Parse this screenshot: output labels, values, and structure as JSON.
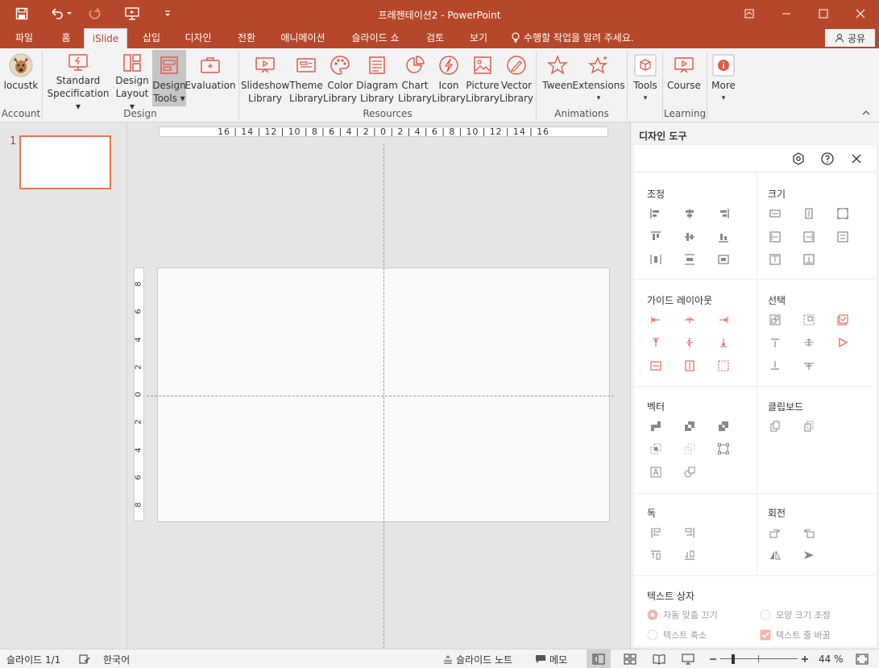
{
  "window": {
    "title": "프레젠테이션2 - PowerPoint"
  },
  "tabs": [
    {
      "label": "파일"
    },
    {
      "label": "홈"
    },
    {
      "label": "iSlide"
    },
    {
      "label": "삽입"
    },
    {
      "label": "디자인"
    },
    {
      "label": "전환"
    },
    {
      "label": "애니메이션"
    },
    {
      "label": "슬라이드 쇼"
    },
    {
      "label": "검토"
    },
    {
      "label": "보기"
    }
  ],
  "tell_me": "수행할 작업을 알려 주세요.",
  "share": "공유",
  "ribbon": {
    "account": {
      "label": "locustk",
      "group": "Account"
    },
    "standard_spec": {
      "line1": "Standard",
      "line2": "Specification"
    },
    "design_layout": {
      "line1": "Design",
      "line2": "Layout"
    },
    "design_tools": {
      "line1": "Design",
      "line2": "Tools"
    },
    "evaluation": {
      "line1": "Evaluation"
    },
    "design_group": "Design",
    "slideshow_lib": {
      "line1": "Slideshow",
      "line2": "Library"
    },
    "theme_lib": {
      "line1": "Theme",
      "line2": "Library"
    },
    "color_lib": {
      "line1": "Color",
      "line2": "Library"
    },
    "diagram_lib": {
      "line1": "Diagram",
      "line2": "Library"
    },
    "chart_lib": {
      "line1": "Chart",
      "line2": "Library"
    },
    "icon_lib": {
      "line1": "Icon",
      "line2": "Library"
    },
    "picture_lib": {
      "line1": "Picture",
      "line2": "Library"
    },
    "vector_lib": {
      "line1": "Vector",
      "line2": "Library"
    },
    "resources_group": "Resources",
    "tween": {
      "line1": "Tween"
    },
    "extensions": {
      "line1": "Extensions"
    },
    "animations_group": "Animations",
    "tools": {
      "line1": "Tools"
    },
    "course": {
      "line1": "Course"
    },
    "learning_group": "Learning",
    "more": {
      "line1": "More"
    }
  },
  "thumbnail": {
    "number": "1"
  },
  "ruler": {
    "h": "16 | 14 | 12 | 10 | 8 | 6 | 4 | 2 | 0 | 2 | 4 | 6 | 8 | 10 | 12 | 14 | 16",
    "v": [
      "8",
      "6",
      "4",
      "2",
      "0",
      "2",
      "4",
      "6",
      "8"
    ]
  },
  "panel": {
    "title": "디자인 도구",
    "sections": {
      "align": "조정",
      "size": "크기",
      "guide": "가이드 레이아웃",
      "select": "선택",
      "vector": "벡터",
      "clipboard": "클립보드",
      "dock": "독",
      "rotate": "회전",
      "textbox": "텍스트 상자"
    },
    "options": {
      "autofit": "자동 맞춤 끄기",
      "resize_shape": "모양 크기 조정",
      "shrink_text": "텍스트 축소",
      "wrap_text": "텍스트 줄 바꿈"
    }
  },
  "status": {
    "slide": "슬라이드 1/1",
    "language": "한국어",
    "notes": "슬라이드 노트",
    "comments": "메모",
    "zoom": "44 %"
  },
  "colors": {
    "accent": "#b7472a",
    "icon_red": "#e05a4a",
    "selection": "#e6764a"
  }
}
